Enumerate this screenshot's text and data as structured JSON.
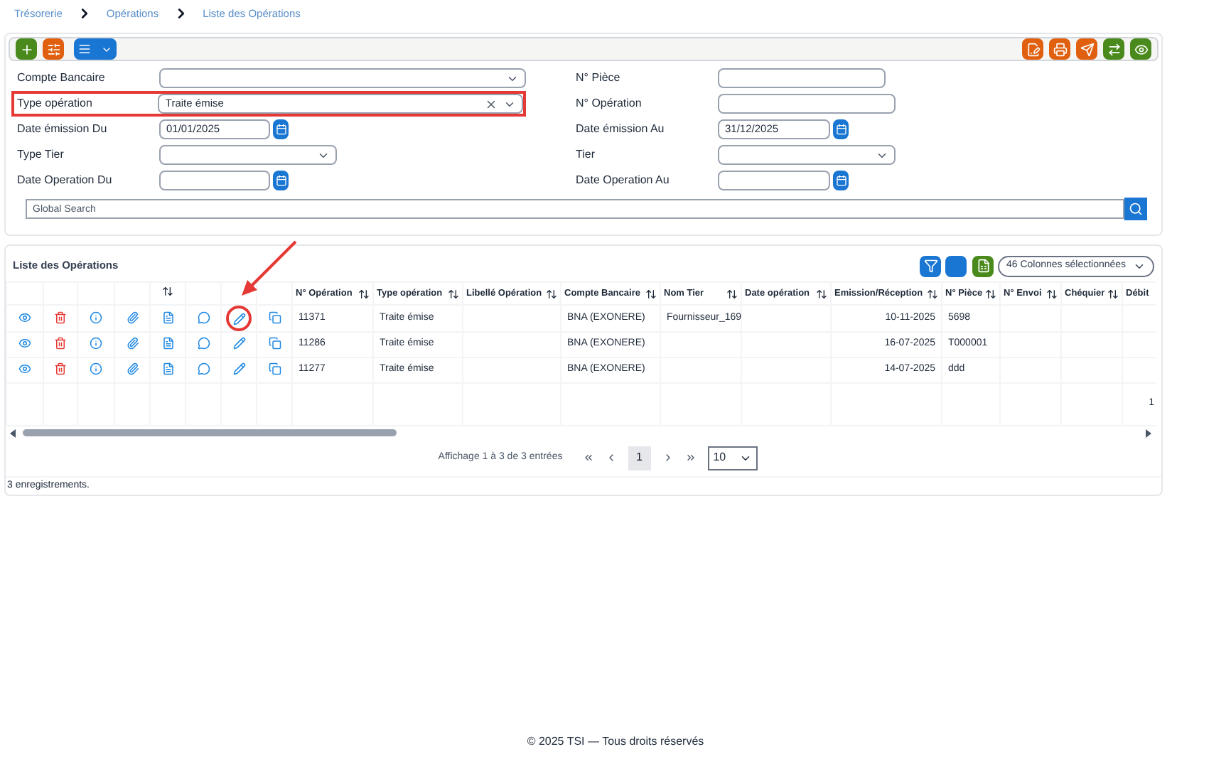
{
  "breadcrumb": [
    "Trésorerie",
    "Opérations",
    "Liste des Opérations"
  ],
  "filters": {
    "left": [
      {
        "label": "Compte Bancaire",
        "kind": "select",
        "highlighted": false
      },
      {
        "label": "Type opération",
        "kind": "select",
        "value": "Traite émise",
        "clearable": true,
        "highlighted": true
      },
      {
        "label": "Date émission Du",
        "kind": "date",
        "value": "01/01/2025",
        "highlighted": false
      },
      {
        "label": "Type Tier",
        "kind": "select",
        "highlighted": false
      },
      {
        "label": "Date Operation Du",
        "kind": "date",
        "highlighted": false
      }
    ],
    "right": [
      {
        "label": "N° Pièce",
        "kind": "text",
        "highlighted": false
      },
      {
        "label": "N° Opération",
        "kind": "text",
        "highlighted": false
      },
      {
        "label": "Date émission Au",
        "kind": "date",
        "value": "31/12/2025",
        "highlighted": false
      },
      {
        "label": "Tier",
        "kind": "select",
        "highlighted": false
      },
      {
        "label": "Date Operation Au",
        "kind": "date",
        "highlighted": false
      }
    ],
    "search": {
      "placeholder": "Global Search"
    }
  },
  "list": {
    "title": "Liste des Opérations",
    "column_selector": "46 Colonnes sélectionnées",
    "action_columns": [
      {
        "sortable": false
      },
      {
        "sortable": false
      },
      {
        "sortable": false
      },
      {
        "sortable": false
      },
      {
        "sortable": true
      },
      {
        "sortable": false
      },
      {
        "sortable": false
      },
      {
        "sortable": false
      }
    ],
    "columns": [
      "N° Opération",
      "Type opération",
      "Libellé Opération",
      "Compte Bancaire",
      "Nom Tier",
      "Date opération",
      "Emission/Réception",
      "N° Pièce",
      "N° Envoi",
      "Chéquier",
      "Débit"
    ],
    "rows": [
      {
        "circled_edit": true,
        "cells": [
          "11371",
          "Traite émise",
          "",
          "BNA (EXONERE)",
          "Fournisseur_169",
          "",
          "10-11-2025",
          "5698",
          "",
          "",
          ""
        ]
      },
      {
        "circled_edit": false,
        "cells": [
          "11286",
          "Traite émise",
          "",
          "BNA (EXONERE)",
          "",
          "",
          "16-07-2025",
          "T000001",
          "",
          "",
          ""
        ]
      },
      {
        "circled_edit": false,
        "cells": [
          "11277",
          "Traite émise",
          "",
          "BNA (EXONERE)",
          "",
          "",
          "14-07-2025",
          "ddd",
          "",
          "",
          ""
        ]
      }
    ],
    "total_fragment": "1",
    "pagination": {
      "summary": "Affichage 1 à 3 de 3 entrées",
      "pages": [
        {
          "label": "1",
          "selected": true
        }
      ],
      "page_size": "10"
    },
    "record_count": "3 enregistrements."
  },
  "footer": "© 2025 TSI — Tous droits réservés"
}
